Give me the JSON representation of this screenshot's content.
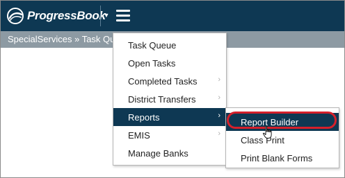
{
  "header": {
    "logo_text": "ProgressBook",
    "dropdown_icon": "caret-down-icon",
    "menu_icon": "hamburger-icon"
  },
  "breadcrumb": {
    "text": "SpecialServices » Task Qu"
  },
  "menu": {
    "items": [
      {
        "label": "Task Queue",
        "has_submenu": false
      },
      {
        "label": "Open Tasks",
        "has_submenu": false
      },
      {
        "label": "Completed Tasks",
        "has_submenu": true
      },
      {
        "label": "District Transfers",
        "has_submenu": true
      },
      {
        "label": "Reports",
        "has_submenu": true,
        "active": true
      },
      {
        "label": "EMIS",
        "has_submenu": true
      },
      {
        "label": "Manage Banks",
        "has_submenu": false
      }
    ],
    "chevron_glyph": "›"
  },
  "submenu": {
    "items": [
      {
        "label": "Report Builder",
        "active": true
      },
      {
        "label": "Class Print"
      },
      {
        "label": "Print Blank Forms"
      }
    ]
  },
  "colors": {
    "header_bg": "#0e3853",
    "breadcrumb_bg": "#8d9aa3",
    "highlight_ring": "#d4202b"
  }
}
